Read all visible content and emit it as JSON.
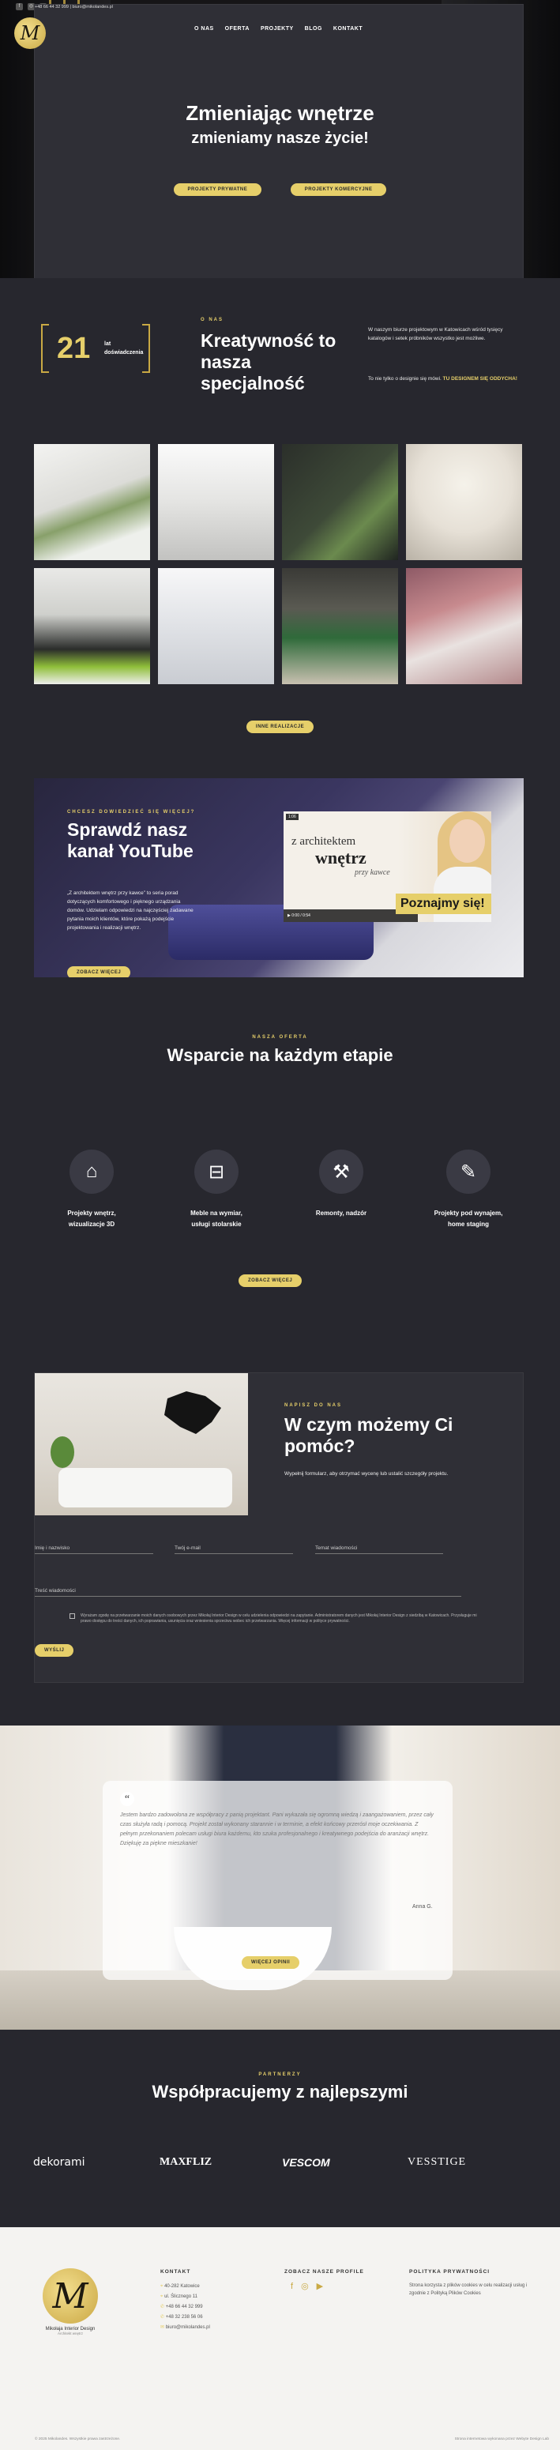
{
  "topbar": {
    "contact": "+48 66 44 32 999 | biuro@mikolandes.pl"
  },
  "nav": {
    "items": [
      "O NAS",
      "OFERTA",
      "PROJEKTY",
      "BLOG",
      "KONTAKT"
    ]
  },
  "hero": {
    "title": "Zmieniając wnętrze",
    "subtitle": "zmieniamy nasze życie!",
    "btn_private": "PROJEKTY PRYWATNE",
    "btn_commercial": "PROJEKTY KOMERCYJNE"
  },
  "about": {
    "years_num": "21",
    "years_label": "lat",
    "years_label2": "doświadczenia",
    "tag": "O NAS",
    "title": "Kreatywność to nasza specjalność",
    "p1": "W naszym biurze projektowym w Katowicach wśród tysięcy katalogów i setek próbników wszystko jest możliwe.",
    "p2_pre": "To nie tylko o designie się mówi.",
    "p2_accent": "TU DESIGNEM SIĘ ODDYCHA!"
  },
  "gallery": {
    "button": "INNE REALIZACJE"
  },
  "youtube": {
    "tag": "CHCESZ DOWIEDZIEĆ SIĘ WIĘCEJ?",
    "title": "Sprawdź nasz kanał YouTube",
    "text": "„Z architektem wnętrz przy kawce” to seria porad dotyczących komfortowego i pięknego urządzania domów. Udzielam odpowiedzi na najczęściej zadawane pytania moich klientów, które pokażą podejście projektowania i realizacji wnętrz.",
    "button": "ZOBACZ WIĘCEJ",
    "video_label": "1:06",
    "video_t1": "z architektem",
    "video_t2": "wnętrz",
    "video_t3": "przy kawce",
    "video_time": "0:00 / 0:54",
    "video_banner": "Poznajmy się!"
  },
  "support": {
    "tag": "NASZA OFERTA",
    "title": "Wsparcie na każdym etapie",
    "features": [
      {
        "icon": "house-icon",
        "line1": "Projekty wnętrz,",
        "line2": "wizualizacje 3D"
      },
      {
        "icon": "bed-icon",
        "line1": "Meble na wymiar,",
        "line2": "usługi stolarskie"
      },
      {
        "icon": "tools-icon",
        "line1": "Remonty, nadzór",
        "line2": ""
      },
      {
        "icon": "pencil-icon",
        "line1": "Projekty pod wynajem,",
        "line2": "home staging"
      }
    ],
    "button": "ZOBACZ WIĘCEJ"
  },
  "contact": {
    "tag": "NAPISZ DO NAS",
    "title": "W czym możemy Ci pomóc?",
    "lead": "Wypełnij formularz, aby otrzymać wycenę lub ustalić szczegóły projektu.",
    "name_ph": "Imię i nazwisko",
    "email_ph": "Twój e-mail",
    "phone_ph": "Temat wiadomości",
    "message_ph": "Treść wiadomości",
    "consent": "Wyrażam zgodę na przetwarzanie moich danych osobowych przez Mikołaj Interior Design w celu udzielenia odpowiedzi na zapytanie. Administratorem danych jest Mikołaj Interior Design z siedzibą w Katowicach. Przysługuje mi prawo dostępu do treści danych, ich poprawiania, usunięcia oraz wniesienia sprzeciwu wobec ich przetwarzania. Więcej informacji w polityce prywatności.",
    "button": "WYŚLIJ"
  },
  "testimonial": {
    "text": "Jestem bardzo zadowolona ze współpracy z panią projektant. Pani wykazała się ogromną wiedzą i zaangażowaniem, przez cały czas służyła radą i pomocą. Projekt został wykonany starannie i w terminie, a efekt końcowy przerósł moje oczekiwania. Z pełnym przekonaniem polecam usługi biura każdemu, kto szuka profesjonalnego i kreatywnego podejścia do aranżacji wnętrz. Dziękuję za piękne mieszkanie!",
    "author": "Anna G.",
    "button": "WIĘCEJ OPINII"
  },
  "partners": {
    "tag": "PARTNERZY",
    "title": "Współpracujemy z najlepszymi",
    "logos": [
      "dekorami",
      "MAXFLIZ",
      "VESCOM",
      "VESSTIGE"
    ]
  },
  "footer": {
    "logo_name": "Mikołaja Interior Design",
    "logo_sub": "Architekt wnętrz",
    "contact_h": "KONTAKT",
    "contact_lines": [
      "40-282 Katowice",
      "ul. Ślicznego 11",
      "+48 66 44 32 999",
      "+48 32 238 56 06",
      "biuro@mikolandes.pl"
    ],
    "social_h": "ZOBACZ NASZE PROFILE",
    "privacy_h": "POLITYKA PRYWATNOŚCI",
    "privacy_text": "Strona korzysta z plików cookies w celu realizacji usług i zgodnie z Polityką Plików Cookies",
    "copyright": "© 2025 Mikolandes. Wszystkie prawa zastrzeżone.",
    "credits": "Strona internetowa wykonana przez Webyte Design Lab"
  }
}
